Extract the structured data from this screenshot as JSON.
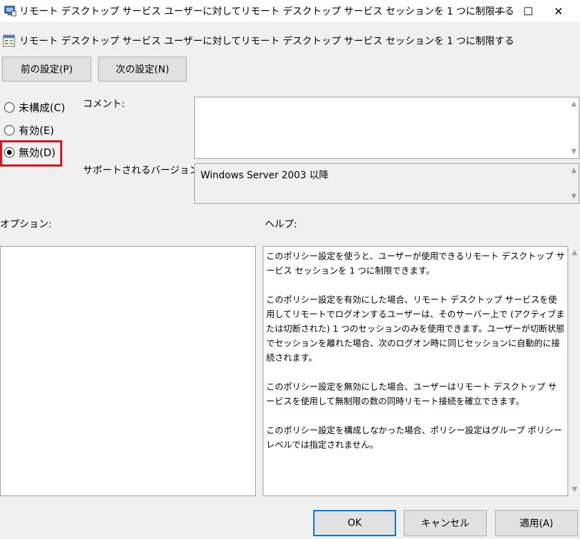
{
  "window": {
    "title": "リモート デスクトップ サービス ユーザーに対してリモート デスクトップ サービス セッションを 1 つに制限する",
    "min_glyph": "—",
    "max_glyph": "☐",
    "close_glyph": "✕"
  },
  "header": {
    "title": "リモート デスクトップ サービス ユーザーに対してリモート デスクトップ サービス セッションを 1 つに制限する"
  },
  "nav": {
    "prev_label": "前の設定(P)",
    "next_label": "次の設定(N)"
  },
  "state": {
    "options": [
      {
        "label": "未構成(C)",
        "checked": false
      },
      {
        "label": "有効(E)",
        "checked": false
      },
      {
        "label": "無効(D)",
        "checked": true
      }
    ]
  },
  "comment": {
    "label": "コメント:",
    "value": ""
  },
  "supported": {
    "label": "サポートされるバージョン:",
    "value": "Windows Server 2003 以降"
  },
  "options_section": {
    "label": "オプション:"
  },
  "help": {
    "label": "ヘルプ:",
    "text": "このポリシー設定を使うと、ユーザーが使用できるリモート デスクトップ サービス セッションを 1 つに制限できます。\n\nこのポリシー設定を有効にした場合、リモート デスクトップ サービスを使用してリモートでログオンするユーザーは、そのサーバー上で (アクティブまたは切断された) 1 つのセッションのみを使用できます。ユーザーが切断状態でセッションを離れた場合、次のログオン時に同じセッションに自動的に接続されます。\n\nこのポリシー設定を無効にした場合、ユーザーはリモート デスクトップ サービスを使用して無制限の数の同時リモート接続を確立できます。\n\nこのポリシー設定を構成しなかった場合、ポリシー設定はグループ ポリシー レベルでは指定されません。"
  },
  "footer": {
    "ok_label": "OK",
    "cancel_label": "キャンセル",
    "apply_label": "適用(A)"
  },
  "colors": {
    "highlight": "#e0101a",
    "default_button_border": "#0078d7"
  }
}
